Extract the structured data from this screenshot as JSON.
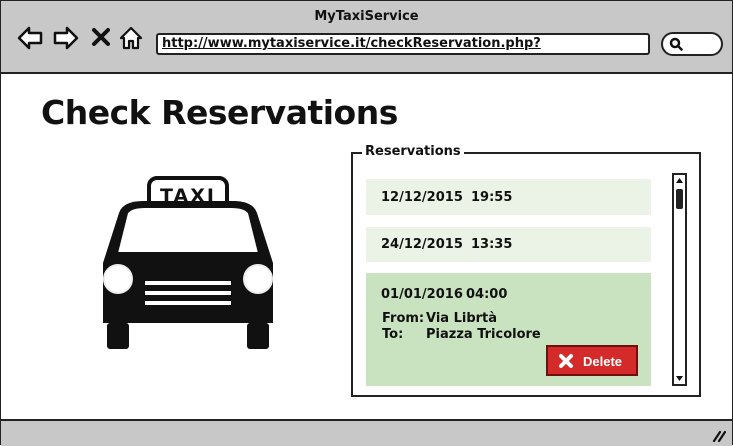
{
  "window": {
    "title": "MyTaxiService",
    "address_url": "http://www.mytaxiservice.it/checkReservation.php?"
  },
  "page": {
    "title": "Check Reservations"
  },
  "taxi_sign": "TAXI",
  "reservations": {
    "legend": "Reservations",
    "items": [
      {
        "date": "12/12/2015",
        "time": "19:55"
      },
      {
        "date": "24/12/2015",
        "time": "13:35"
      },
      {
        "date": "01/01/2016",
        "time": "04:00",
        "from_label": "From:",
        "from": "Via Librtà",
        "to_label": "To:",
        "to": "Piazza Tricolore",
        "selected": true
      }
    ],
    "delete_label": "Delete"
  },
  "colors": {
    "chrome": "#c8c8c8",
    "row": "#ebf3e6",
    "row_selected": "#c9e2c0",
    "delete": "#d52a2a"
  }
}
